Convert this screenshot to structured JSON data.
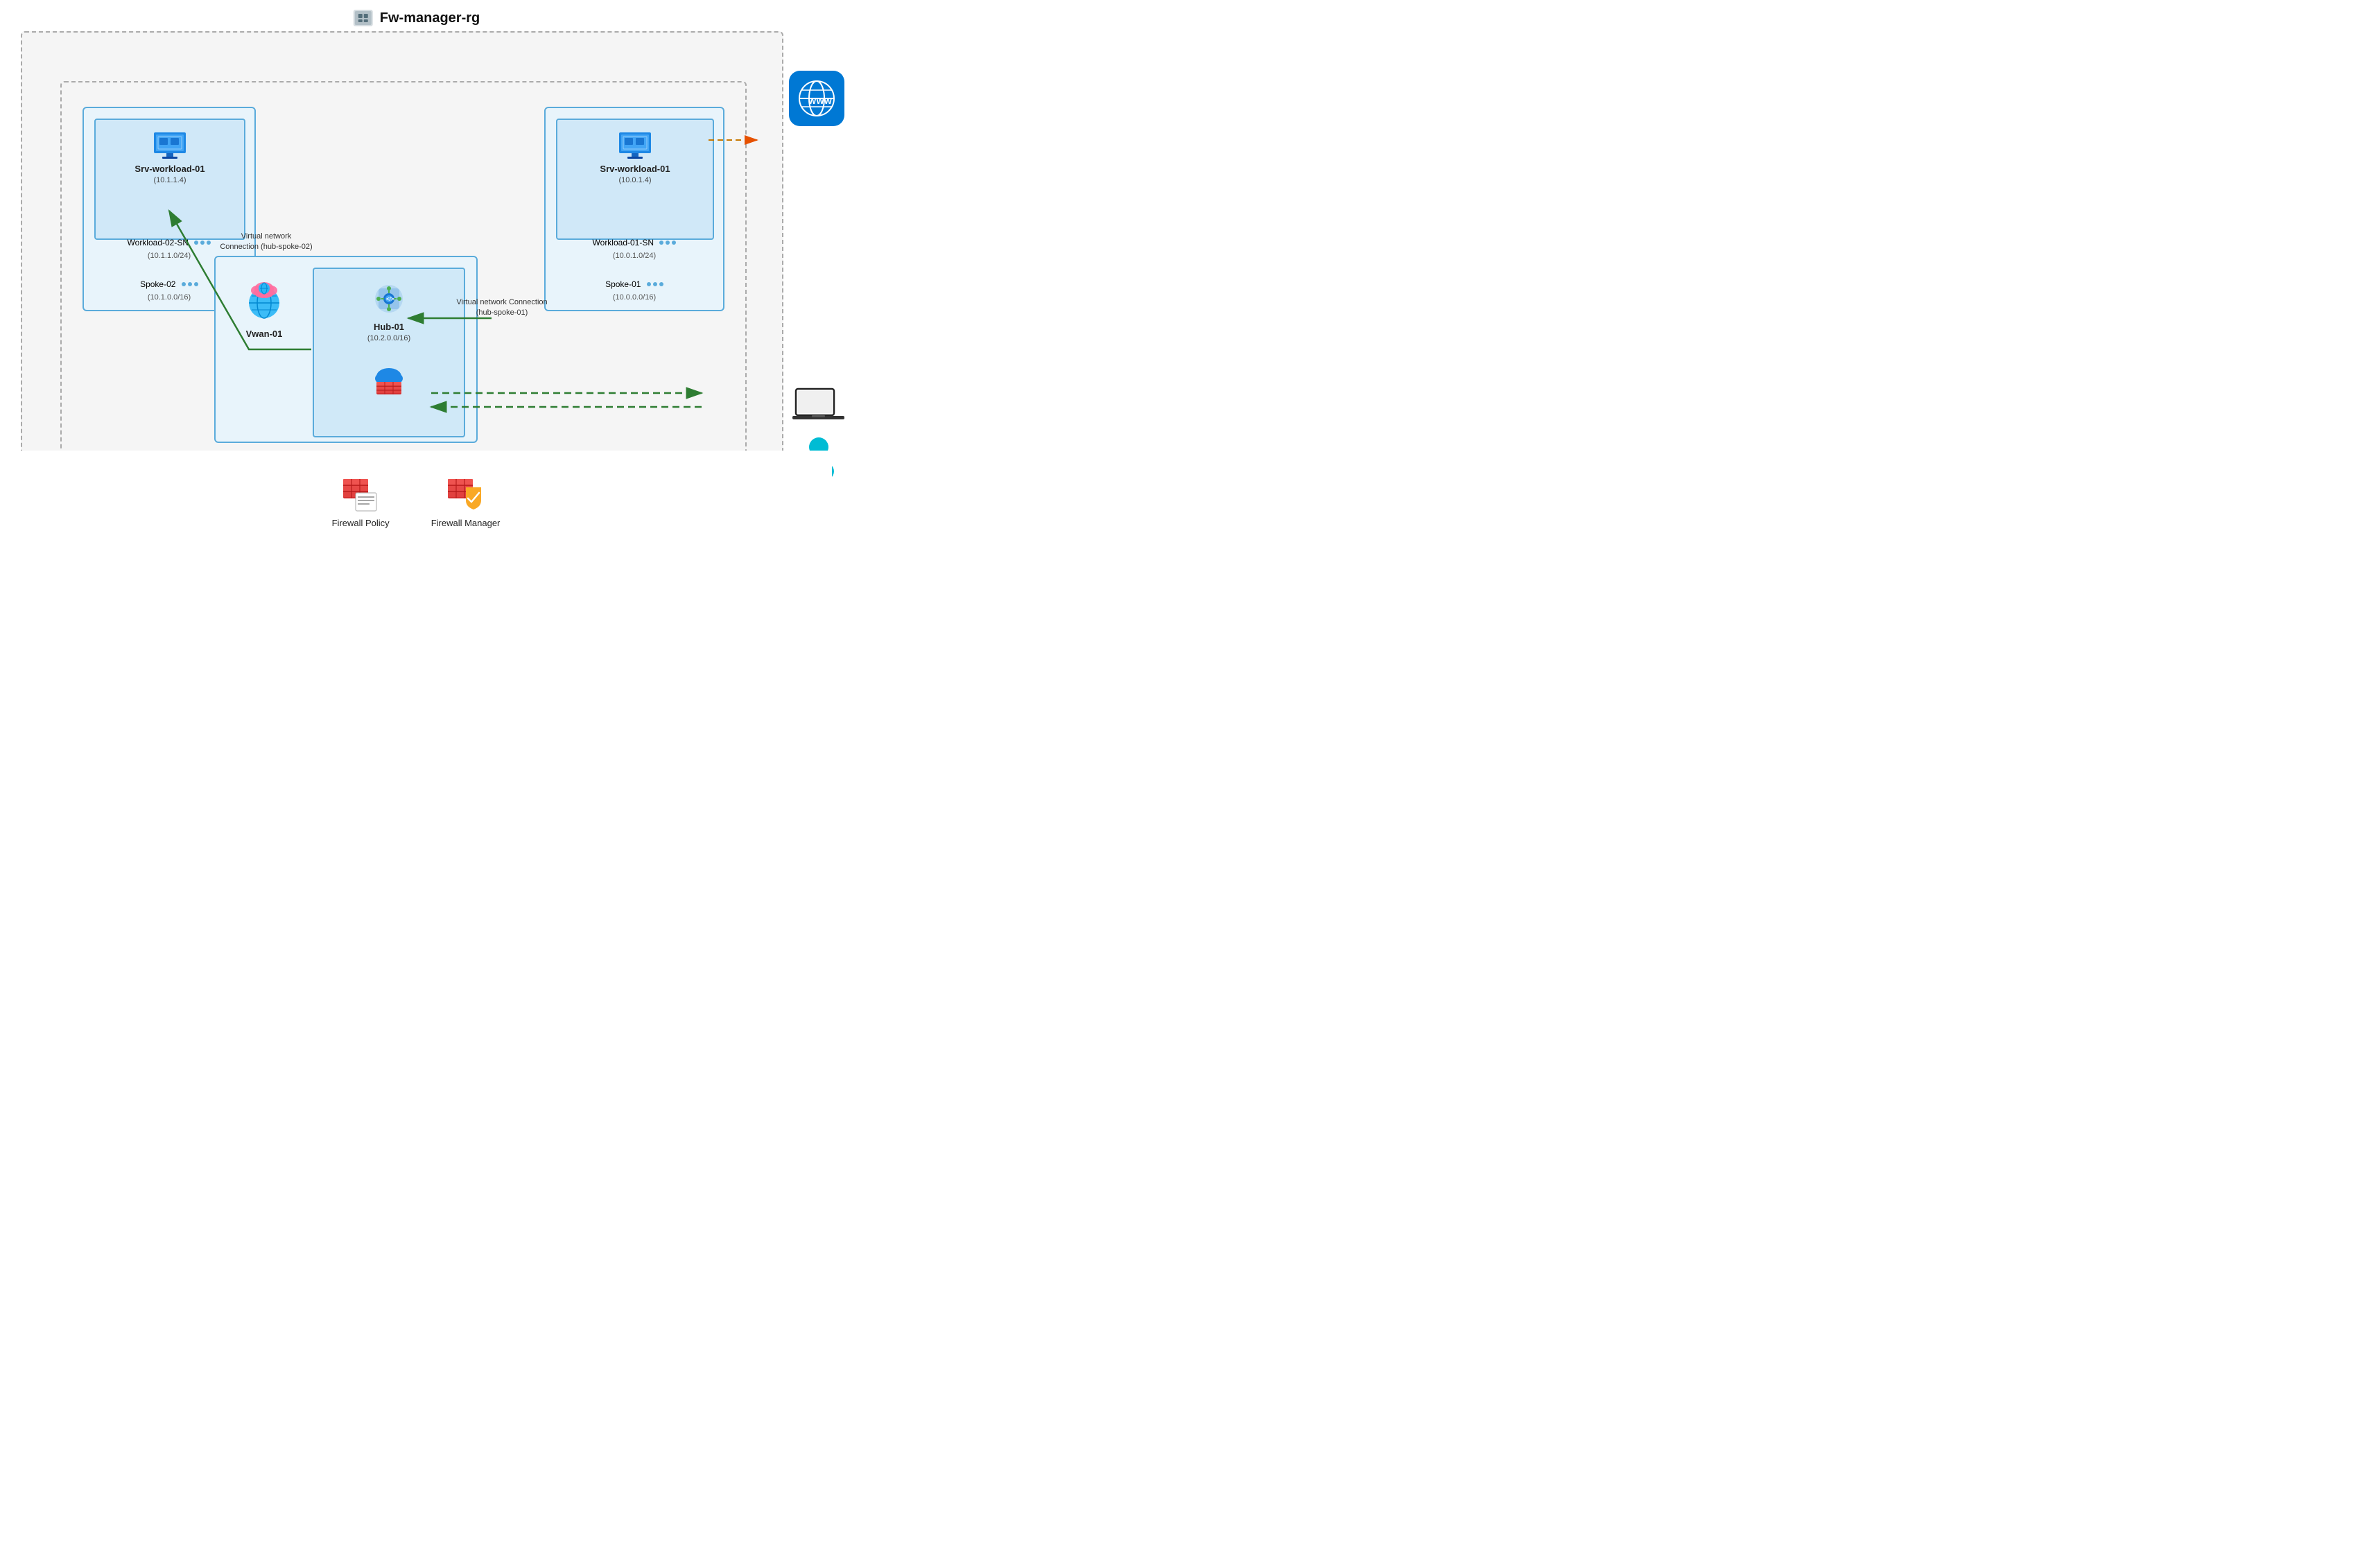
{
  "diagram": {
    "title": "Fw-manager-rg",
    "spoke02": {
      "vm_name": "Srv-workload-01",
      "vm_ip": "(10.1.1.4)",
      "sn_name": "Workload-02-SN",
      "sn_cidr": "(10.1.1.0/24)",
      "spoke_name": "Spoke-02",
      "spoke_cidr": "(10.1.0.0/16)"
    },
    "spoke01": {
      "vm_name": "Srv-workload-01",
      "vm_ip": "(10.0.1.4)",
      "sn_name": "Workload-01-SN",
      "sn_cidr": "(10.0.1.0/24)",
      "spoke_name": "Spoke-01",
      "spoke_cidr": "(10.0.0.0/16)"
    },
    "vwan": {
      "name": "Vwan-01"
    },
    "hub": {
      "name": "Hub-01",
      "cidr": "(10.2.0.0/16)"
    },
    "connections": {
      "hub_spoke02": "Virtual network\nConnection (hub-spoke-02)",
      "hub_spoke01": "Virtual network Connection\n(hub-spoke-01)"
    },
    "legend": {
      "firewall_policy": "Firewall Policy",
      "firewall_manager": "Firewall Manager"
    }
  }
}
